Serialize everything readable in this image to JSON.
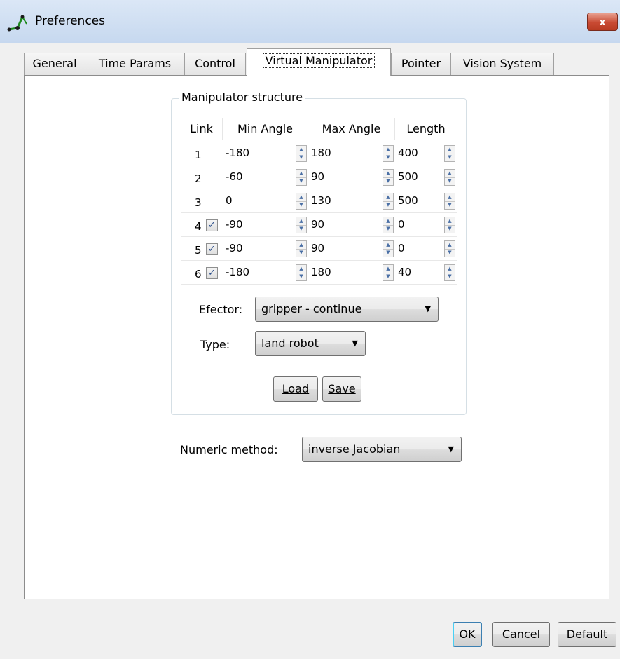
{
  "window": {
    "title": "Preferences",
    "close_glyph": "x"
  },
  "tabs": [
    {
      "label": "General",
      "active": false
    },
    {
      "label": "Time Params",
      "active": false
    },
    {
      "label": "Control",
      "active": false
    },
    {
      "label": "Virtual Manipulator",
      "active": true
    },
    {
      "label": "Pointer",
      "active": false
    },
    {
      "label": "Vision System",
      "active": false
    }
  ],
  "manipulator": {
    "group_title": "Manipulator structure",
    "columns": [
      "Link",
      "Min Angle",
      "Max Angle",
      "Length"
    ],
    "rows": [
      {
        "link": "1",
        "checked": false,
        "min": "-180",
        "max": "180",
        "length": "400"
      },
      {
        "link": "2",
        "checked": false,
        "min": "-60",
        "max": "90",
        "length": "500"
      },
      {
        "link": "3",
        "checked": false,
        "min": "0",
        "max": "130",
        "length": "500"
      },
      {
        "link": "4",
        "checked": true,
        "min": "-90",
        "max": "90",
        "length": "0"
      },
      {
        "link": "5",
        "checked": true,
        "min": "-90",
        "max": "90",
        "length": "0"
      },
      {
        "link": "6",
        "checked": true,
        "min": "-180",
        "max": "180",
        "length": "40"
      }
    ],
    "efector_label": "Efector:",
    "efector_value": "gripper - continue",
    "type_label": "Type:",
    "type_value": "land robot",
    "load_label": "Load",
    "save_label": "Save"
  },
  "numeric": {
    "label": "Numeric method:",
    "value": "inverse Jacobian"
  },
  "footer": {
    "ok_label": "OK",
    "cancel_label": "Cancel",
    "default_label": "Default"
  },
  "icons": {
    "app": "robot-arm-icon",
    "close": "close-icon",
    "dropdown": "chevron-down-icon",
    "spin": "spin-arrows-icon",
    "check": "checkmark-icon"
  },
  "colors": {
    "accent": "#3c7fb1",
    "close": "#c94a33",
    "titlebar": "#c6d8ef"
  }
}
